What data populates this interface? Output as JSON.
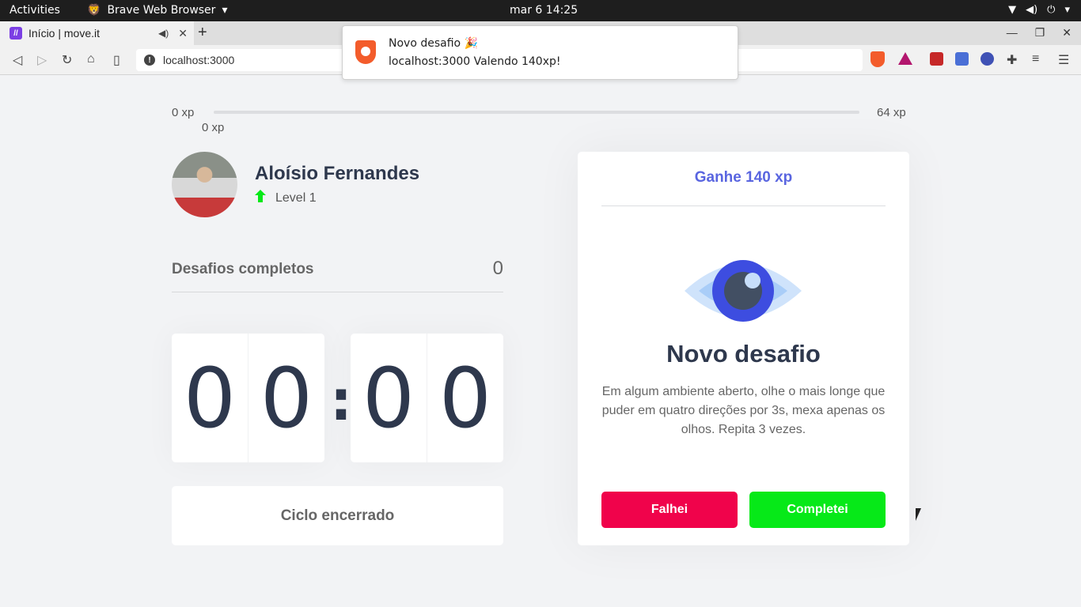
{
  "os": {
    "activities": "Activities",
    "app_name": "Brave Web Browser",
    "clock": "mar 6  14:25"
  },
  "browser": {
    "tab_title": "Início | move.it",
    "url": "localhost:3000"
  },
  "notification": {
    "title": "Novo desafio 🎉",
    "body": "localhost:3000  Valendo 140xp!"
  },
  "xp": {
    "start": "0 xp",
    "current": "0 xp",
    "end": "64 xp",
    "progress_fraction": 0
  },
  "profile": {
    "name": "Aloísio Fernandes",
    "level": "Level 1"
  },
  "challenges": {
    "label": "Desafios completos",
    "count": "0"
  },
  "countdown": {
    "minute_tens": "0",
    "minute_ones": "0",
    "separator": ":",
    "second_tens": "0",
    "second_ones": "0"
  },
  "cycle_button": "Ciclo encerrado",
  "challenge_card": {
    "header": "Ganhe 140 xp",
    "title": "Novo desafio",
    "description": "Em algum ambiente aberto, olhe o mais longe que puder em quatro direções por 3s, mexa apenas os olhos. Repita 3 vezes.",
    "fail_label": "Falhei",
    "done_label": "Completei"
  },
  "colors": {
    "accent": "#5965e0",
    "fail": "#f0034b",
    "success": "#06e918",
    "text": "#2e384d"
  }
}
